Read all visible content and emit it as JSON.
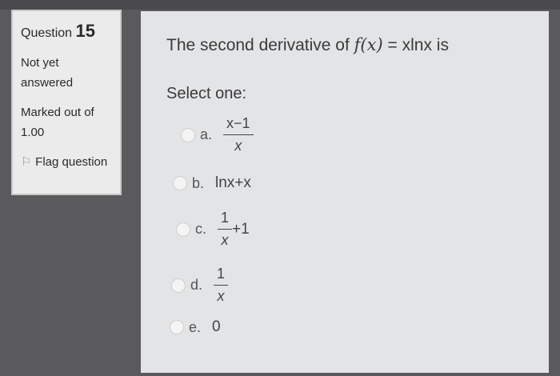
{
  "sidebar": {
    "question_label": "Question",
    "question_number": "15",
    "status": "Not yet answered",
    "marked_label": "Marked out of",
    "marked_value": "1.00",
    "flag_label": "Flag question"
  },
  "question": {
    "prefix": "The second derivative of",
    "function": "f(x)",
    "equals": "= xlnx is",
    "select_label": "Select one:"
  },
  "options": [
    {
      "letter": "a.",
      "numerator": "x−1",
      "denominator": "x"
    },
    {
      "letter": "b.",
      "expression": "lnx+x"
    },
    {
      "letter": "c.",
      "numerator": "1",
      "denominator": "x",
      "suffix": "+1"
    },
    {
      "letter": "d.",
      "numerator": "1",
      "denominator": "x"
    },
    {
      "letter": "e.",
      "expression": "0"
    }
  ]
}
